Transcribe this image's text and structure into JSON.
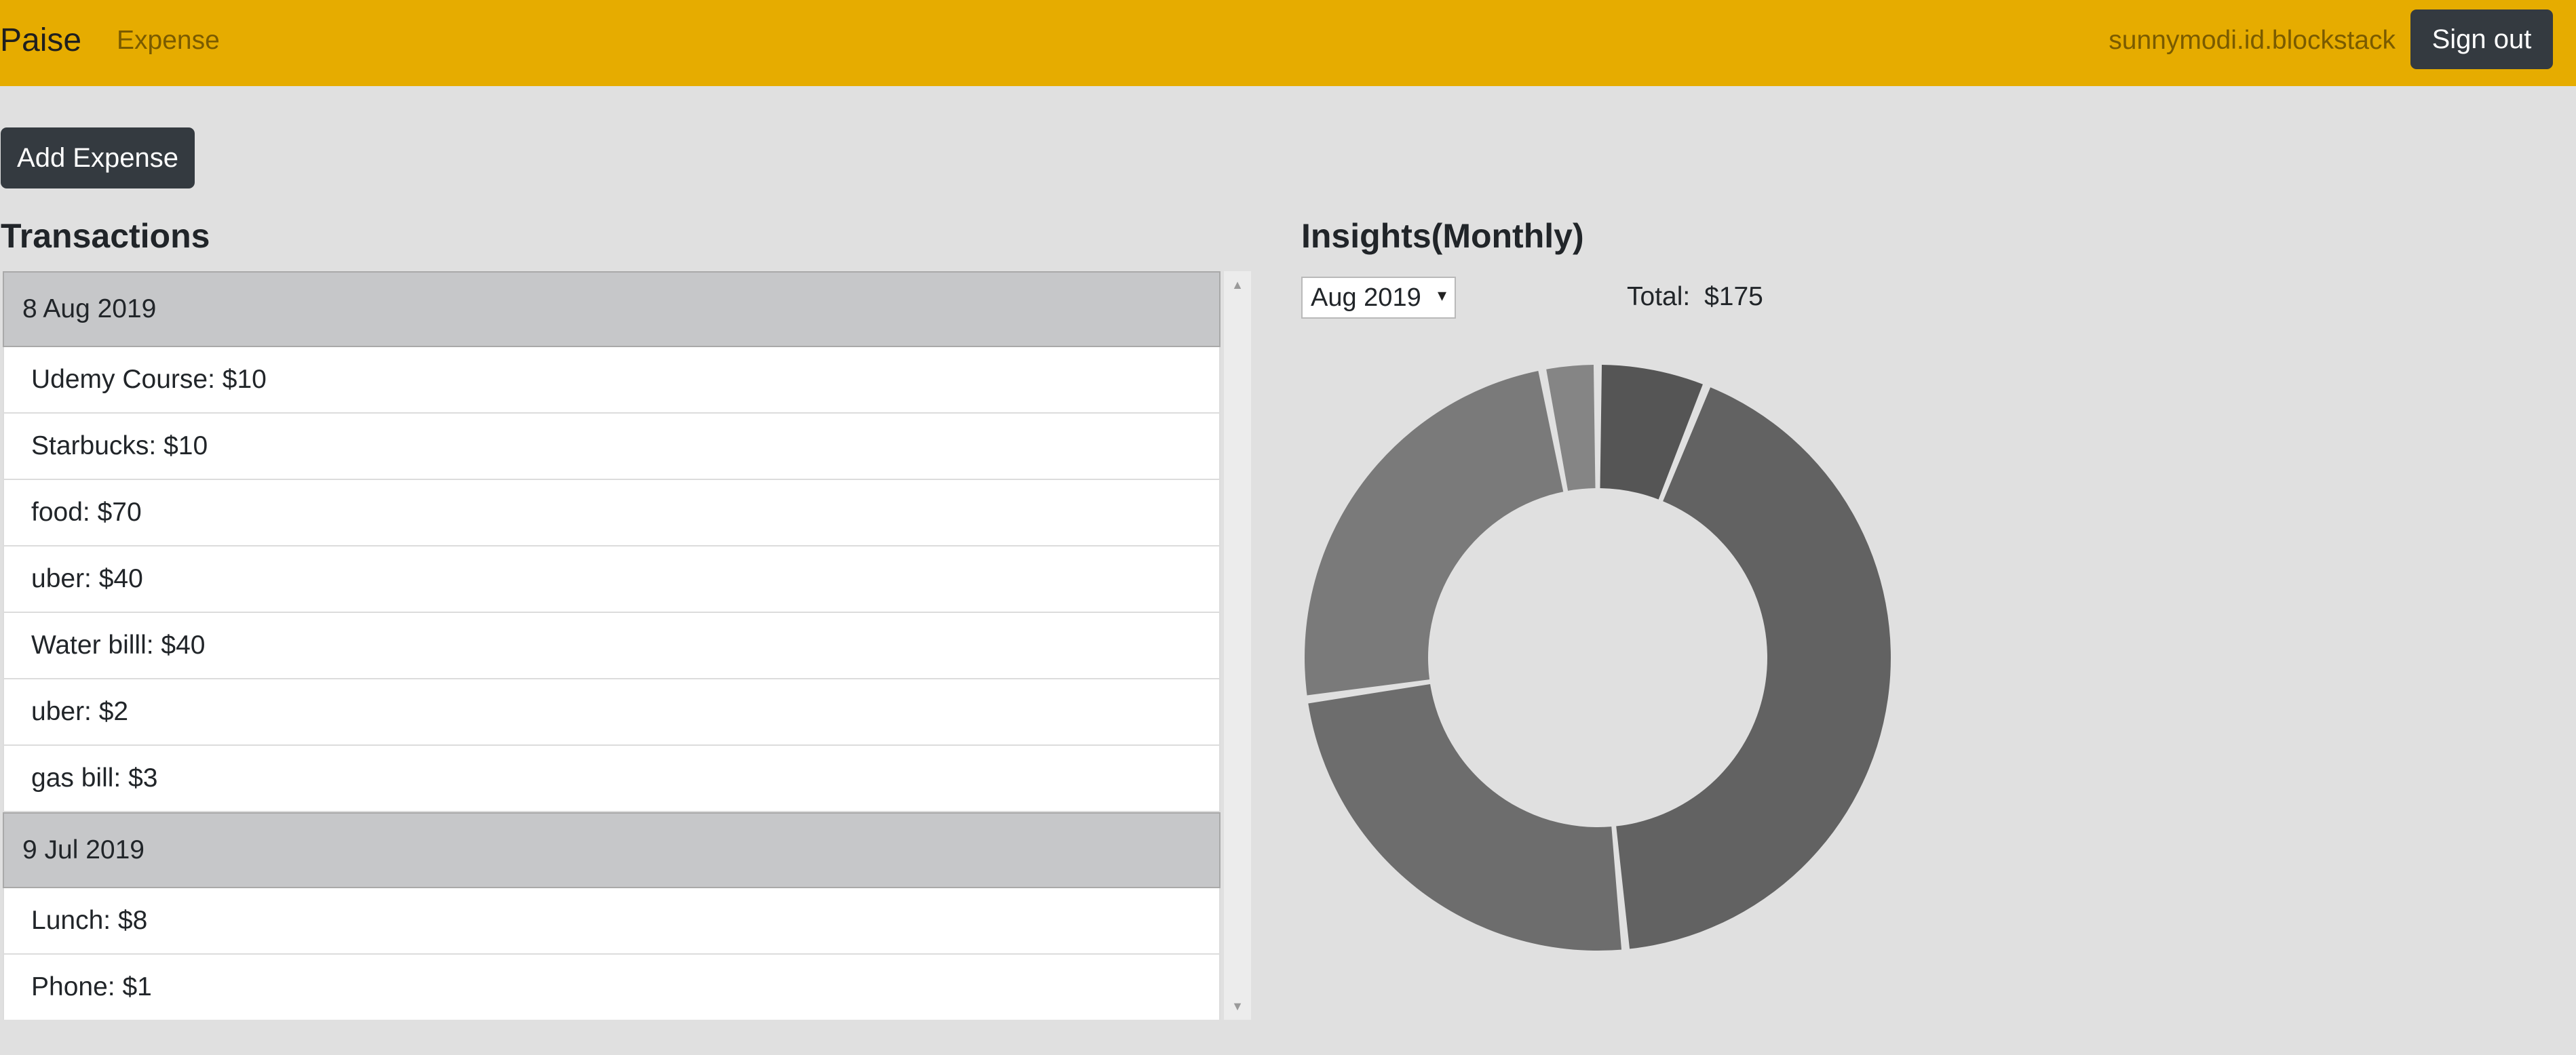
{
  "navbar": {
    "brand": "Paise",
    "link": "Expense",
    "user": "sunnymodi.id.blockstack",
    "signout_label": "Sign out"
  },
  "actions": {
    "add_expense_label": "Add Expense"
  },
  "transactions": {
    "title": "Transactions",
    "groups": [
      {
        "date": "8 Aug 2019",
        "items": [
          "Udemy Course: $10",
          "Starbucks: $10",
          "food: $70",
          "uber: $40",
          "Water billl: $40",
          "uber: $2",
          "gas bill: $3"
        ]
      },
      {
        "date": "9 Jul 2019",
        "items": [
          "Lunch: $8",
          "Phone: $1"
        ]
      }
    ]
  },
  "insights": {
    "title": "Insights(Monthly)",
    "selected_month": "Aug 2019",
    "total_label": "Total:",
    "total_value": "$175"
  },
  "colors": {
    "navbar": "#e6ac00",
    "background": "#e0e0e0",
    "button_dark": "#343a40",
    "group_header": "#c6c7c9",
    "slice_darkest": "#555555",
    "slice_dark": "#626262",
    "slice_mid": "#6d6d6d",
    "slice_light": "#7a7a7a",
    "slice_lighter": "#858585"
  },
  "chart_data": {
    "type": "pie",
    "variant": "doughnut",
    "values": [
      10,
      70,
      40,
      40,
      5
    ],
    "colors": [
      "#555555",
      "#626262",
      "#6d6d6d",
      "#7a7a7a",
      "#858585"
    ]
  }
}
